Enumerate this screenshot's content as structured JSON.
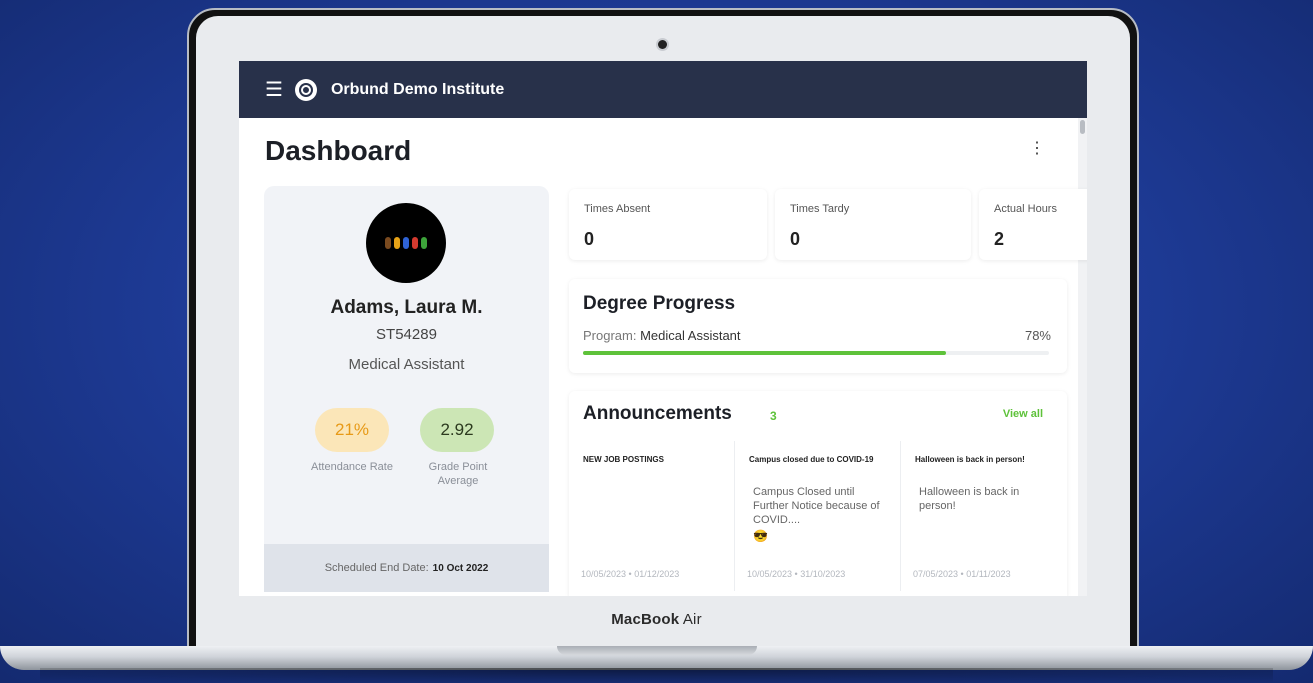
{
  "device": {
    "label_brand": "MacBook",
    "label_model": "Air"
  },
  "app": {
    "institution_name": "Orbund Demo Institute"
  },
  "page": {
    "title": "Dashboard"
  },
  "student": {
    "name": "Adams, Laura M.",
    "id": "ST54289",
    "program": "Medical Assistant",
    "attendance_rate": "21%",
    "attendance_label": "Attendance Rate",
    "gpa": "2.92",
    "gpa_label": "Grade Point Average",
    "end_date_label": "Scheduled End Date:",
    "end_date_value": "10 Oct 2022",
    "avatar_colors": [
      "#7a4a1f",
      "#e8a317",
      "#2f63d6",
      "#d43a2f",
      "#3da33a"
    ]
  },
  "metrics": [
    {
      "label": "Times Absent",
      "value": "0"
    },
    {
      "label": "Times Tardy",
      "value": "0"
    },
    {
      "label": "Actual Hours",
      "value": "2"
    }
  ],
  "degree_progress": {
    "title": "Degree Progress",
    "program_prefix": "Program:",
    "program_name": "Medical Assistant",
    "percent_label": "78%",
    "percent": 78
  },
  "announcements": {
    "title": "Announcements",
    "count": "3",
    "view_all": "View all",
    "items": [
      {
        "headline": "NEW JOB POSTINGS",
        "body": "",
        "dates": "10/05/2023  •  01/12/2023"
      },
      {
        "headline": "Campus closed due to COVID-19",
        "body": "Campus Closed until Further Notice because of COVID....",
        "emoji": "😎",
        "dates": "10/05/2023  •  31/10/2023"
      },
      {
        "headline": "Halloween is back in person!",
        "body": "Halloween is back in person!",
        "dates": "07/05/2023  •  01/11/2023"
      }
    ]
  },
  "colors": {
    "background": "#1f3d9b",
    "topbar": "#28314a",
    "accent_green": "#5ec23a",
    "attendance_pill": "#fbe6b8",
    "gpa_pill": "#cce6b5"
  },
  "icons": {
    "menu": "hamburger-icon",
    "logo": "orbund-logo-icon",
    "more": "kebab-menu-icon"
  }
}
